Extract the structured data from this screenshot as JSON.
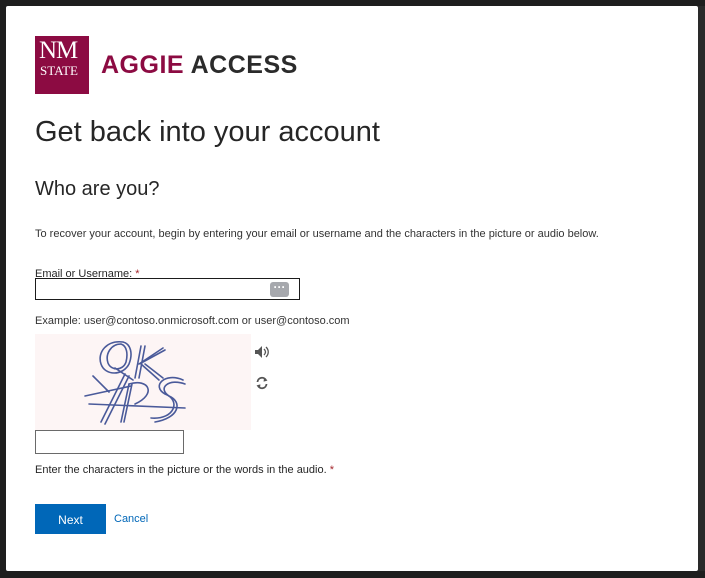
{
  "brand": {
    "logo_line1": "NM",
    "logo_line2": "STATE",
    "name_part1": "AGGIE",
    "name_part2": "ACCESS",
    "primary_color": "#8c0b42"
  },
  "page": {
    "title": "Get back into your account",
    "subtitle": "Who are you?",
    "instructions": "To recover your account, begin by entering your email or username and the characters in the picture or audio below."
  },
  "email": {
    "label": "Email or Username:",
    "required_marker": "*",
    "value": "",
    "example": "Example: user@contoso.onmicrosoft.com or user@contoso.com",
    "password_manager_icon": "ellipsis-icon"
  },
  "captcha": {
    "image_text": "QK YPS",
    "audio_icon": "speaker-icon",
    "refresh_icon": "refresh-icon",
    "value": "",
    "hint": "Enter the characters in the picture or the words in the audio.",
    "required_marker": "*"
  },
  "actions": {
    "next_label": "Next",
    "cancel_label": "Cancel",
    "accent_color": "#0067b8"
  }
}
